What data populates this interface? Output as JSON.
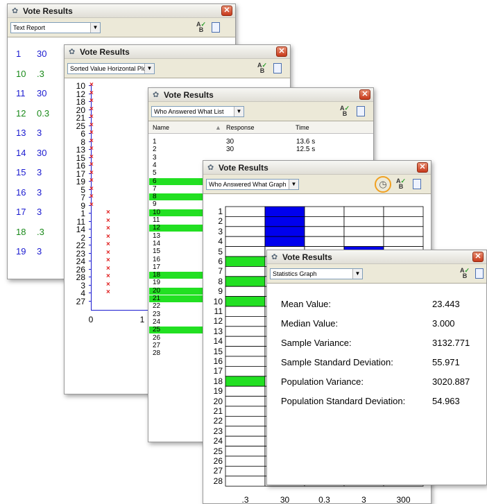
{
  "text_report": {
    "title": "Vote Results",
    "view": "Text Report",
    "rows": [
      {
        "name": "1",
        "value": "30",
        "color": "#1a1ad0"
      },
      {
        "name": "10",
        "value": ".3",
        "color": "#1a8a1a"
      },
      {
        "name": "11",
        "value": "30",
        "color": "#1a1ad0"
      },
      {
        "name": "12",
        "value": "0.3",
        "color": "#1a8a1a"
      },
      {
        "name": "13",
        "value": "3",
        "color": "#1a1ad0"
      },
      {
        "name": "14",
        "value": "30",
        "color": "#1a1ad0"
      },
      {
        "name": "15",
        "value": "3",
        "color": "#1a1ad0"
      },
      {
        "name": "16",
        "value": "3",
        "color": "#1a1ad0"
      },
      {
        "name": "17",
        "value": "3",
        "color": "#1a1ad0"
      },
      {
        "name": "18",
        "value": ".3",
        "color": "#1a8a1a"
      },
      {
        "name": "19",
        "value": "3",
        "color": "#1a1ad0"
      }
    ]
  },
  "sorted_plot": {
    "title": "Vote Results",
    "view": "Sorted Value Horizontal Plot",
    "labels": [
      "10",
      "12",
      "18",
      "20",
      "21",
      "25",
      "6",
      "8",
      "13",
      "15",
      "16",
      "17",
      "19",
      "5",
      "7",
      "9",
      "1",
      "11",
      "14",
      "2",
      "22",
      "23",
      "24",
      "26",
      "28",
      "3",
      "4",
      "27"
    ],
    "marks_col": [
      0,
      0,
      0,
      0,
      0,
      0,
      0,
      0,
      0,
      0,
      0,
      0,
      0,
      0,
      0,
      0,
      1,
      1,
      1,
      1,
      1,
      1,
      1,
      1,
      1,
      1,
      1,
      -1
    ],
    "x_ticks": [
      "0",
      "1"
    ]
  },
  "answer_list": {
    "title": "Vote Results",
    "view": "Who Answered What List",
    "columns": [
      "Name",
      "Response",
      "Time"
    ],
    "rows": [
      {
        "name": "1",
        "response": "30",
        "time": "13.6 s",
        "hl": false
      },
      {
        "name": "2",
        "response": "30",
        "time": "12.5 s",
        "hl": false
      },
      {
        "name": "3",
        "response": "",
        "time": "",
        "hl": false
      },
      {
        "name": "4",
        "response": "",
        "time": "",
        "hl": false
      },
      {
        "name": "5",
        "response": "",
        "time": "",
        "hl": false
      },
      {
        "name": "6",
        "response": "",
        "time": "",
        "hl": true
      },
      {
        "name": "7",
        "response": "",
        "time": "",
        "hl": false
      },
      {
        "name": "8",
        "response": "",
        "time": "",
        "hl": true
      },
      {
        "name": "9",
        "response": "",
        "time": "",
        "hl": false
      },
      {
        "name": "10",
        "response": "",
        "time": "",
        "hl": true
      },
      {
        "name": "11",
        "response": "",
        "time": "",
        "hl": false
      },
      {
        "name": "12",
        "response": "",
        "time": "",
        "hl": true
      },
      {
        "name": "13",
        "response": "",
        "time": "",
        "hl": false
      },
      {
        "name": "14",
        "response": "",
        "time": "",
        "hl": false
      },
      {
        "name": "15",
        "response": "",
        "time": "",
        "hl": false
      },
      {
        "name": "16",
        "response": "",
        "time": "",
        "hl": false
      },
      {
        "name": "17",
        "response": "",
        "time": "",
        "hl": false
      },
      {
        "name": "18",
        "response": "",
        "time": "",
        "hl": true
      },
      {
        "name": "19",
        "response": "",
        "time": "",
        "hl": false
      },
      {
        "name": "20",
        "response": "",
        "time": "",
        "hl": true
      },
      {
        "name": "21",
        "response": "",
        "time": "",
        "hl": true
      },
      {
        "name": "22",
        "response": "",
        "time": "",
        "hl": false
      },
      {
        "name": "23",
        "response": "",
        "time": "",
        "hl": false
      },
      {
        "name": "24",
        "response": "",
        "time": "",
        "hl": false
      },
      {
        "name": "25",
        "response": "",
        "time": "",
        "hl": true
      },
      {
        "name": "26",
        "response": "",
        "time": "",
        "hl": false
      },
      {
        "name": "27",
        "response": "",
        "time": "",
        "hl": false
      },
      {
        "name": "28",
        "response": "",
        "time": "",
        "hl": false
      }
    ]
  },
  "answer_graph": {
    "title": "Vote Results",
    "view": "Who Answered What Graph",
    "rows": [
      "1",
      "2",
      "3",
      "4",
      "5",
      "6",
      "7",
      "8",
      "9",
      "10",
      "11",
      "12",
      "13",
      "14",
      "15",
      "16",
      "17",
      "18",
      "19",
      "20",
      "21",
      "22",
      "23",
      "24",
      "25",
      "26",
      "27",
      "28"
    ],
    "columns": [
      ".3",
      "30",
      "0.3",
      "3",
      "300"
    ],
    "filled": {
      "0": 1,
      "1": 1,
      "2": 1,
      "3": 1,
      "4": 3,
      "5": 0,
      "7": 0,
      "9": 0,
      "17": 0
    },
    "fill_colors": {
      "blue": "#0000ee",
      "green": "#22e022"
    }
  },
  "statistics": {
    "title": "Vote Results",
    "view": "Statistics Graph",
    "items": [
      {
        "label": "Mean Value:",
        "value": "23.443"
      },
      {
        "label": "Median Value:",
        "value": "3.000"
      },
      {
        "label": "Sample Variance:",
        "value": "3132.771"
      },
      {
        "label": "Sample Standard Deviation:",
        "value": "55.971"
      },
      {
        "label": "Population Variance:",
        "value": "3020.887"
      },
      {
        "label": "Population Standard Deviation:",
        "value": "54.963"
      }
    ]
  },
  "icons": {
    "title": "vote-results-icon",
    "sort": "sort-ab-icon",
    "print": "print-preview-icon",
    "clock": "timer-icon",
    "close": "close-icon"
  }
}
